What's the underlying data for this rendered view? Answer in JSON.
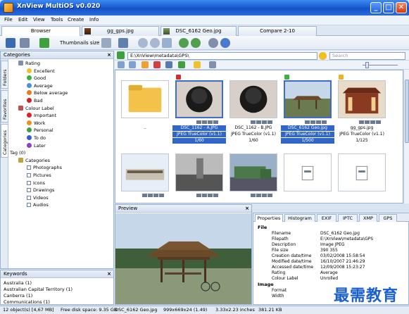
{
  "window": {
    "title": "XnView MultiOS v0.020",
    "min": "_",
    "max": "□",
    "close": "✕"
  },
  "menu": [
    "File",
    "Edit",
    "View",
    "Tools",
    "Create",
    "Info"
  ],
  "doc_tabs": [
    "Browser",
    "gg_gps.jpg",
    "DSC_6162 Geo.jpg",
    "Compare 2-10"
  ],
  "toolbar": {
    "thumbnails_label": "Thumbnails size"
  },
  "categories_panel": {
    "title": "Categories",
    "side_tabs": [
      "Folders",
      "Favorites",
      "Categories"
    ],
    "tree": [
      {
        "label": "Rating",
        "level": 1,
        "color": "#7e8fb0"
      },
      {
        "label": "Excellent",
        "level": 2,
        "color": "#f0c020"
      },
      {
        "label": "Good",
        "level": 2,
        "color": "#36b040"
      },
      {
        "label": "Average",
        "level": 2,
        "color": "#4a90e0"
      },
      {
        "label": "Below average",
        "level": 2,
        "color": "#e08020"
      },
      {
        "label": "Bad",
        "level": 2,
        "color": "#d02020"
      },
      {
        "label": "Colour Label",
        "level": 1,
        "color": "#c0504d"
      },
      {
        "label": "Important",
        "level": 2,
        "color": "#e02020"
      },
      {
        "label": "Work",
        "level": 2,
        "color": "#f09020"
      },
      {
        "label": "Personal",
        "level": 2,
        "color": "#40a040"
      },
      {
        "label": "To do",
        "level": 2,
        "color": "#3060d0"
      },
      {
        "label": "Later",
        "level": 2,
        "color": "#9040c0"
      },
      {
        "label": "Tag (0)",
        "level": 0,
        "color": ""
      },
      {
        "label": "Categories",
        "level": 1,
        "color": "#c0a040"
      },
      {
        "label": "Photographs",
        "level": 2,
        "color": ""
      },
      {
        "label": "Pictures",
        "level": 2,
        "color": ""
      },
      {
        "label": "Icons",
        "level": 2,
        "color": ""
      },
      {
        "label": "Drawings",
        "level": 2,
        "color": ""
      },
      {
        "label": "Videos",
        "level": 2,
        "color": ""
      },
      {
        "label": "Audios",
        "level": 2,
        "color": ""
      }
    ]
  },
  "keywords_panel": {
    "title": "Keywords",
    "items": [
      "Australia (1)",
      "Australian Capital Territory (1)",
      "Canberra (1)",
      "Communications (1)"
    ]
  },
  "path": {
    "value": "E:\\XnView\\metadata\\GPS\\",
    "search_placeholder": "Search"
  },
  "thumbnails": [
    {
      "name": "..",
      "info": "",
      "dims": "",
      "kind": "folder",
      "selected": false,
      "flag": ""
    },
    {
      "name": "DSC_1162 - A.JPG",
      "info": "JPEG TrueColor (v1.1)",
      "dims": "1/60",
      "kind": "lens",
      "selected": true,
      "flag": "#d03030"
    },
    {
      "name": "DSC_1162 - B.JPG",
      "info": "JPEG TrueColor (v1.1)",
      "dims": "1/60",
      "kind": "lens",
      "selected": false,
      "flag": ""
    },
    {
      "name": "DSC_6162 Geo.jpg",
      "info": "JPEG TrueColor (v1.1)",
      "dims": "1/500",
      "kind": "gazebo",
      "selected": true,
      "flag": "#40b040"
    },
    {
      "name": "gg_gps.jpg",
      "info": "JPEG TrueColor (v1.1)",
      "dims": "1/125",
      "kind": "temple",
      "selected": false,
      "flag": "#f0b020"
    },
    {
      "name": "",
      "info": "",
      "dims": "",
      "kind": "building",
      "selected": false,
      "flag": ""
    },
    {
      "name": "",
      "info": "",
      "dims": "",
      "kind": "street",
      "selected": false,
      "flag": ""
    },
    {
      "name": "",
      "info": "",
      "dims": "",
      "kind": "truck",
      "selected": false,
      "flag": ""
    },
    {
      "name": "",
      "info": "",
      "dims": "",
      "kind": "file",
      "selected": false,
      "flag": ""
    },
    {
      "name": "",
      "info": "",
      "dims": "",
      "kind": "file",
      "selected": false,
      "flag": ""
    }
  ],
  "preview": {
    "title": "Preview"
  },
  "properties": {
    "tabs": [
      "Properties",
      "Histogram",
      "EXIF",
      "IPTC",
      "XMP",
      "GPS"
    ],
    "sections": [
      {
        "title": "File",
        "rows": [
          [
            "Filename",
            "DSC_6162 Geo.jpg"
          ],
          [
            "Filepath",
            "E:\\XnView\\metadata\\GPS"
          ],
          [
            "Description",
            "Image JPEG"
          ],
          [
            "File size",
            "390 355"
          ],
          [
            "Creation date/time",
            "03/02/2008 15:58:54"
          ],
          [
            "Modified date/time",
            "16/10/2007 21:46:29"
          ],
          [
            "Accessed date/time",
            "12/09/2008 15:23:27"
          ],
          [
            "Rating",
            "Average"
          ],
          [
            "Colour Label",
            "Unrolled"
          ]
        ]
      },
      {
        "title": "Image",
        "rows": [
          [
            "Format",
            ""
          ],
          [
            "Width",
            ""
          ]
        ]
      }
    ]
  },
  "status": {
    "objects": "12 object(s) [4,67 MB]",
    "free": "Free disk space: 9.35 GB",
    "file": "DSC_6162 Geo.jpg",
    "dims": "999x669x24 (1.49)",
    "inches": "3.33x2.23 inches",
    "size": "381.21 KB"
  },
  "watermark": "最需教育"
}
